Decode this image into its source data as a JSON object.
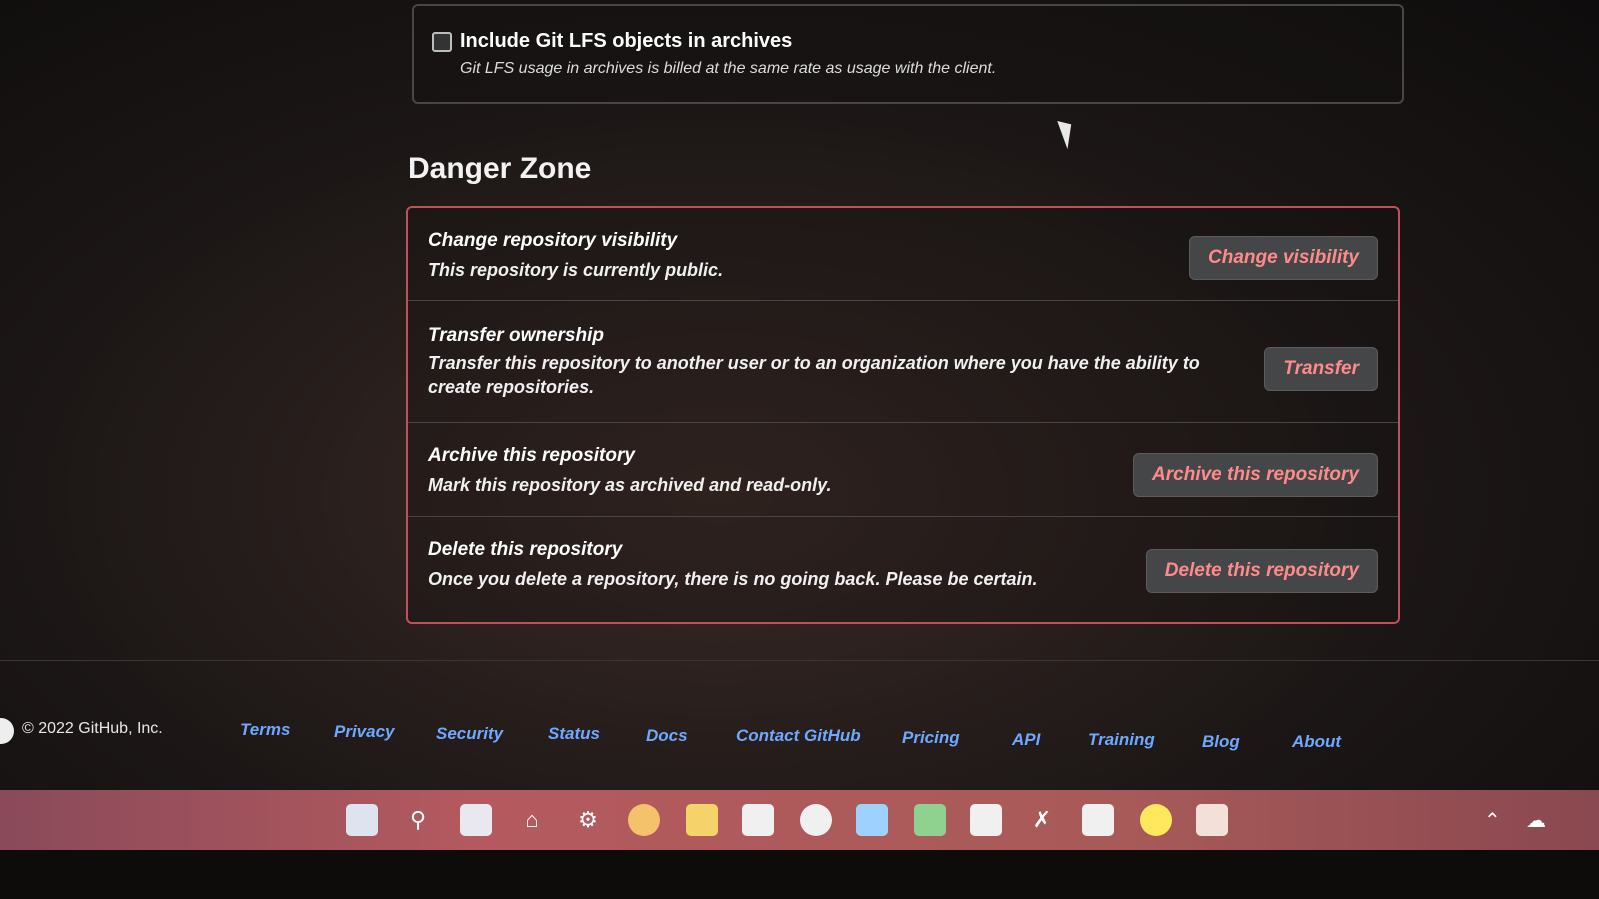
{
  "lfs": {
    "label": "Include Git LFS objects in archives",
    "description": "Git LFS usage in archives is billed at the same rate as usage with the client."
  },
  "danger_zone": {
    "title": "Danger Zone",
    "rows": [
      {
        "title": "Change repository visibility",
        "description": "This repository is currently public.",
        "button": "Change visibility"
      },
      {
        "title": "Transfer ownership",
        "description": "Transfer this repository to another user or to an organization where you have the ability to create repositories.",
        "button": "Transfer"
      },
      {
        "title": "Archive this repository",
        "description": "Mark this repository as archived and read-only.",
        "button": "Archive this repository"
      },
      {
        "title": "Delete this repository",
        "description": "Once you delete a repository, there is no going back. Please be certain.",
        "button": "Delete this repository"
      }
    ]
  },
  "footer": {
    "copyright": "© 2022 GitHub, Inc.",
    "links": [
      "Terms",
      "Privacy",
      "Security",
      "Status",
      "Docs",
      "Contact GitHub",
      "Pricing",
      "API",
      "Training",
      "Blog",
      "About"
    ]
  },
  "taskbar": {
    "icons": [
      "start-icon",
      "search-icon",
      "task-view-icon",
      "home-icon",
      "settings-icon",
      "photos-icon",
      "file-explorer-icon",
      "store-icon",
      "chrome-icon",
      "mail-icon",
      "excel-icon",
      "notepad-icon",
      "vscode-icon",
      "app-icon",
      "browser-icon",
      "document-icon"
    ],
    "tray": [
      "chevron-up-icon",
      "network-icon"
    ]
  },
  "colors": {
    "danger_border": "#c0505a",
    "danger_text": "#ff8a8a",
    "link": "#6fa8ff"
  }
}
